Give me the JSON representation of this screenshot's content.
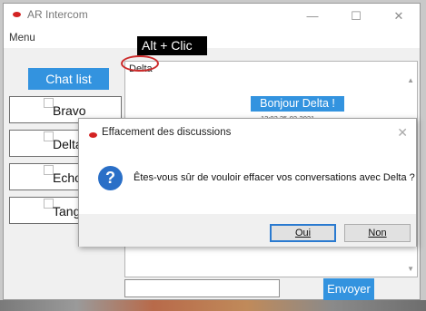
{
  "window": {
    "title": "AR Intercom",
    "minimize_glyph": "—",
    "maximize_glyph": "☐",
    "close_glyph": "✕"
  },
  "menu": {
    "label": "Menu"
  },
  "annotation": {
    "text": "Alt + Clic"
  },
  "sidebar": {
    "chat_list_label": "Chat list",
    "contacts": [
      {
        "label": "Bravo"
      },
      {
        "label": "Delta"
      },
      {
        "label": "Echo"
      },
      {
        "label": "Tango"
      }
    ]
  },
  "conversation": {
    "header": "Delta",
    "message": {
      "text": "Bonjour Delta !",
      "time": "12:02  25-02-2021"
    },
    "input_value": "",
    "send_label": "Envoyer"
  },
  "dialog": {
    "title": "Effacement des discussions",
    "icon_glyph": "?",
    "message": "Êtes-vous sûr de vouloir effacer vos conversations avec Delta ?",
    "yes_label": "Oui",
    "no_label": "Non",
    "close_glyph": "✕"
  },
  "colors": {
    "accent": "#3393df",
    "app_icon": "#d32222",
    "annotation_ring": "#cc2b2b",
    "question_icon": "#2a6fc7"
  },
  "icons": {
    "app": "app-logo-icon",
    "question": "question-icon"
  }
}
